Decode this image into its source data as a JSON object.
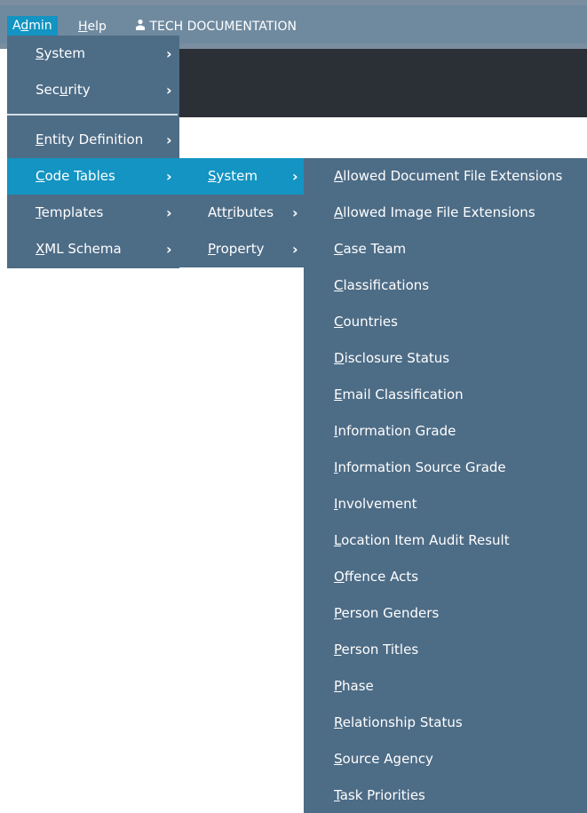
{
  "menubar": {
    "admin_prefix": "A",
    "admin_u": "d",
    "admin_suffix": "min",
    "help_u": "H",
    "help_suffix": "elp",
    "user_icon": "user-icon",
    "user_label": "TECH DOCUMENTATION"
  },
  "admin_menu": {
    "items": [
      {
        "pre": "",
        "u": "S",
        "post": "ystem"
      },
      {
        "pre": "Sec",
        "u": "u",
        "post": "rity"
      },
      {
        "pre": "",
        "u": "E",
        "post": "ntity Definition"
      },
      {
        "pre": "",
        "u": "C",
        "post": "ode Tables"
      },
      {
        "pre": "",
        "u": "T",
        "post": "emplates"
      },
      {
        "pre": "",
        "u": "X",
        "post": "ML Schema"
      }
    ]
  },
  "code_tables_menu": {
    "items": [
      {
        "pre": "",
        "u": "S",
        "post": "ystem"
      },
      {
        "pre": "Att",
        "u": "r",
        "post": "ibutes"
      },
      {
        "pre": "",
        "u": "P",
        "post": "roperty"
      }
    ]
  },
  "system_menu": {
    "items": [
      {
        "pre": "",
        "u": "A",
        "post": "llowed Document File Extensions"
      },
      {
        "pre": "",
        "u": "A",
        "post": "llowed Image File Extensions"
      },
      {
        "pre": "",
        "u": "C",
        "post": "ase Team"
      },
      {
        "pre": "",
        "u": "C",
        "post": "lassifications"
      },
      {
        "pre": "",
        "u": "C",
        "post": "ountries"
      },
      {
        "pre": "",
        "u": "D",
        "post": "isclosure Status"
      },
      {
        "pre": "",
        "u": "E",
        "post": "mail Classification"
      },
      {
        "pre": "",
        "u": "I",
        "post": "nformation Grade"
      },
      {
        "pre": "",
        "u": "I",
        "post": "nformation Source Grade"
      },
      {
        "pre": "",
        "u": "I",
        "post": "nvolvement"
      },
      {
        "pre": "",
        "u": "L",
        "post": "ocation Item Audit Result"
      },
      {
        "pre": "",
        "u": "O",
        "post": "ffence Acts"
      },
      {
        "pre": "",
        "u": "P",
        "post": "erson Genders"
      },
      {
        "pre": "",
        "u": "P",
        "post": "erson Titles"
      },
      {
        "pre": "",
        "u": "P",
        "post": "hase"
      },
      {
        "pre": "",
        "u": "R",
        "post": "elationship Status"
      },
      {
        "pre": "",
        "u": "S",
        "post": "ource Agency"
      },
      {
        "pre": "",
        "u": "T",
        "post": "ask Priorities"
      }
    ]
  },
  "chevron": "›",
  "colors": {
    "accent": "#1394c2",
    "menu_bg": "#4d6c86",
    "menubar_bg": "#6f8a9f"
  }
}
